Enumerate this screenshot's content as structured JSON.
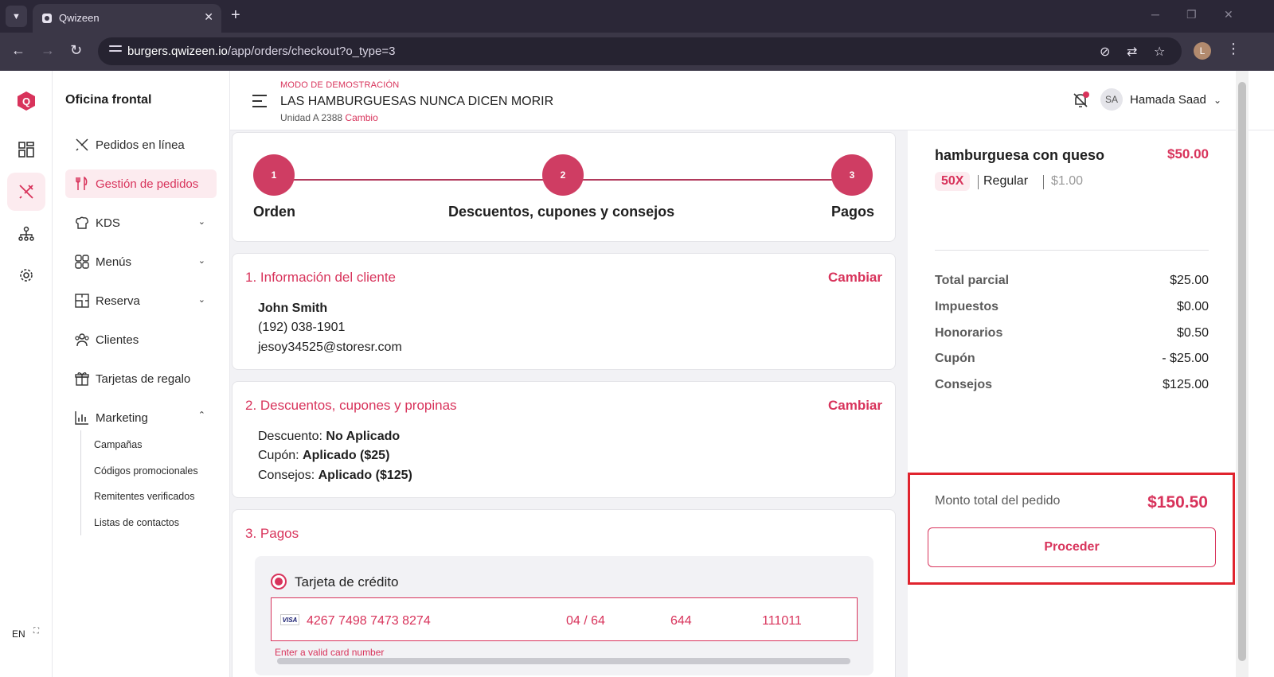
{
  "browser": {
    "tab_title": "Qwizeen",
    "url_host": "burgers.qwizeen.io",
    "url_path": "/app/orders/checkout?o_type=3",
    "profile_initial": "L"
  },
  "rail": {
    "logo_letter": "Q",
    "language": "EN"
  },
  "sidebar": {
    "title": "Oficina frontal",
    "items": [
      {
        "label": "Pedidos en línea"
      },
      {
        "label": "Gestión de pedidos"
      },
      {
        "label": "KDS"
      },
      {
        "label": "Menús"
      },
      {
        "label": "Reserva"
      },
      {
        "label": "Clientes"
      },
      {
        "label": "Tarjetas de regalo"
      },
      {
        "label": "Marketing"
      }
    ],
    "marketing_sub": [
      {
        "label": "Campañas"
      },
      {
        "label": "Códigos promocionales"
      },
      {
        "label": "Remitentes verificados"
      },
      {
        "label": "Listas de contactos"
      }
    ]
  },
  "header": {
    "demo_label": "MODO DE DEMOSTRACIÓN",
    "restaurant_name": "LAS HAMBURGUESAS NUNCA DICEN MORIR",
    "unit": "Unidad A 2388",
    "unit_change": "Cambio",
    "user_initials": "SA",
    "user_name": "Hamada Saad"
  },
  "stepper": {
    "steps": [
      {
        "number": "1",
        "label": "Orden"
      },
      {
        "number": "2",
        "label": "Descuentos, cupones y consejos"
      },
      {
        "number": "3",
        "label": "Pagos"
      }
    ]
  },
  "customer": {
    "title": "1. Información del cliente",
    "change": "Cambiar",
    "name": "John Smith",
    "phone": "(192) 038-1901",
    "email": "jesoy34525@storesr.com"
  },
  "discounts": {
    "title": "2. Descuentos, cupones y propinas",
    "change": "Cambiar",
    "discount_label": "Descuento:",
    "discount_value": "No Aplicado",
    "coupon_label": "Cupón:",
    "coupon_value": "Aplicado ($25)",
    "tips_label": "Consejos:",
    "tips_value": "Aplicado ($125)"
  },
  "payments": {
    "title": "3. Pagos",
    "option_label": "Tarjeta de crédito",
    "card_brand": "VISA",
    "card_number": "4267 7498 7473 8274",
    "expiry": "04 / 64",
    "cvc": "644",
    "zip": "111011",
    "error": "Enter a valid card number"
  },
  "summary": {
    "item_name": "hamburguesa con queso",
    "item_price": "$50.00",
    "item_qty": "50X",
    "item_variant": "Regular",
    "item_unit_price": "$1.00",
    "rows": [
      {
        "label": "Total parcial",
        "value": "$25.00"
      },
      {
        "label": "Impuestos",
        "value": "$0.00"
      },
      {
        "label": "Honorarios",
        "value": "$0.50"
      },
      {
        "label": "Cupón",
        "value": "- $25.00"
      },
      {
        "label": "Consejos",
        "value": "$125.00"
      }
    ],
    "total_label": "Monto total del pedido",
    "total_value": "$150.50",
    "proceed_label": "Proceder"
  },
  "colors": {
    "accent": "#d8335b",
    "highlight_border": "#e0242e",
    "chrome_dark": "#2b2737"
  }
}
